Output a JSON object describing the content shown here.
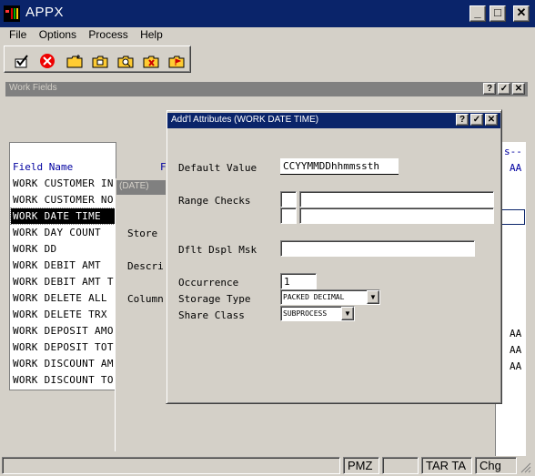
{
  "app": {
    "title": "APPX"
  },
  "window_buttons": {
    "minimize": "_",
    "maximize": "□",
    "close": "✕"
  },
  "menu": [
    {
      "label": "File"
    },
    {
      "label": "Options"
    },
    {
      "label": "Process"
    },
    {
      "label": "Help"
    }
  ],
  "toolbar": {
    "buttons": [
      {
        "icon": "checkmark-edit-icon"
      },
      {
        "icon": "cancel-icon"
      },
      {
        "icon": "folder-new-icon"
      },
      {
        "icon": "folder-open-icon"
      },
      {
        "icon": "folder-search-icon"
      },
      {
        "icon": "folder-delete-icon"
      },
      {
        "icon": "folder-flag-icon"
      }
    ]
  },
  "work_fields": {
    "title": "Work Fields",
    "buttons": {
      "help": "?",
      "ok": "✓",
      "close": "✕"
    },
    "column_header": "Field Name",
    "column_header_2": "F",
    "right_header": "s--",
    "right_col_header": "AA",
    "rows": [
      "WORK CUSTOMER IN",
      "WORK CUSTOMER NO",
      "WORK DATE TIME",
      "WORK DAY COUNT",
      "WORK DD",
      "WORK DEBIT AMT",
      "WORK DEBIT AMT T",
      "WORK DELETE ALL",
      "WORK DELETE TRX",
      "WORK DEPOSIT AMO",
      "WORK DEPOSIT TOT",
      "WORK DISCOUNT AM",
      "WORK DISCOUNT TO"
    ],
    "selected_row": "WORK DATE TIME",
    "aa_values": [
      "AA",
      "AA",
      "AA"
    ]
  },
  "mid_panel": {
    "title": "(DATE)",
    "labels": [
      "Store",
      "Descri",
      "Column"
    ]
  },
  "dialog": {
    "title": "Add'l Attributes (WORK DATE TIME)",
    "buttons": {
      "help": "?",
      "ok": "✓",
      "close": "✕"
    },
    "default_value_label": "Default Value",
    "default_value": "CCYYMMDDhhmmssth",
    "range_checks_label": "Range Checks",
    "range_from": "",
    "range_to": "",
    "dflt_dspl_msk_label": "Dflt Dspl Msk",
    "dflt_dspl_msk": "",
    "occurrence_label": "Occurrence",
    "occurrence": "1",
    "storage_type_label": "Storage Type",
    "storage_type": "PACKED DECIMAL",
    "share_class_label": "Share Class",
    "share_class": "SUBPROCESS"
  },
  "status_bar": {
    "segments": [
      "PMZ",
      "TAR TA",
      "Chg"
    ]
  }
}
